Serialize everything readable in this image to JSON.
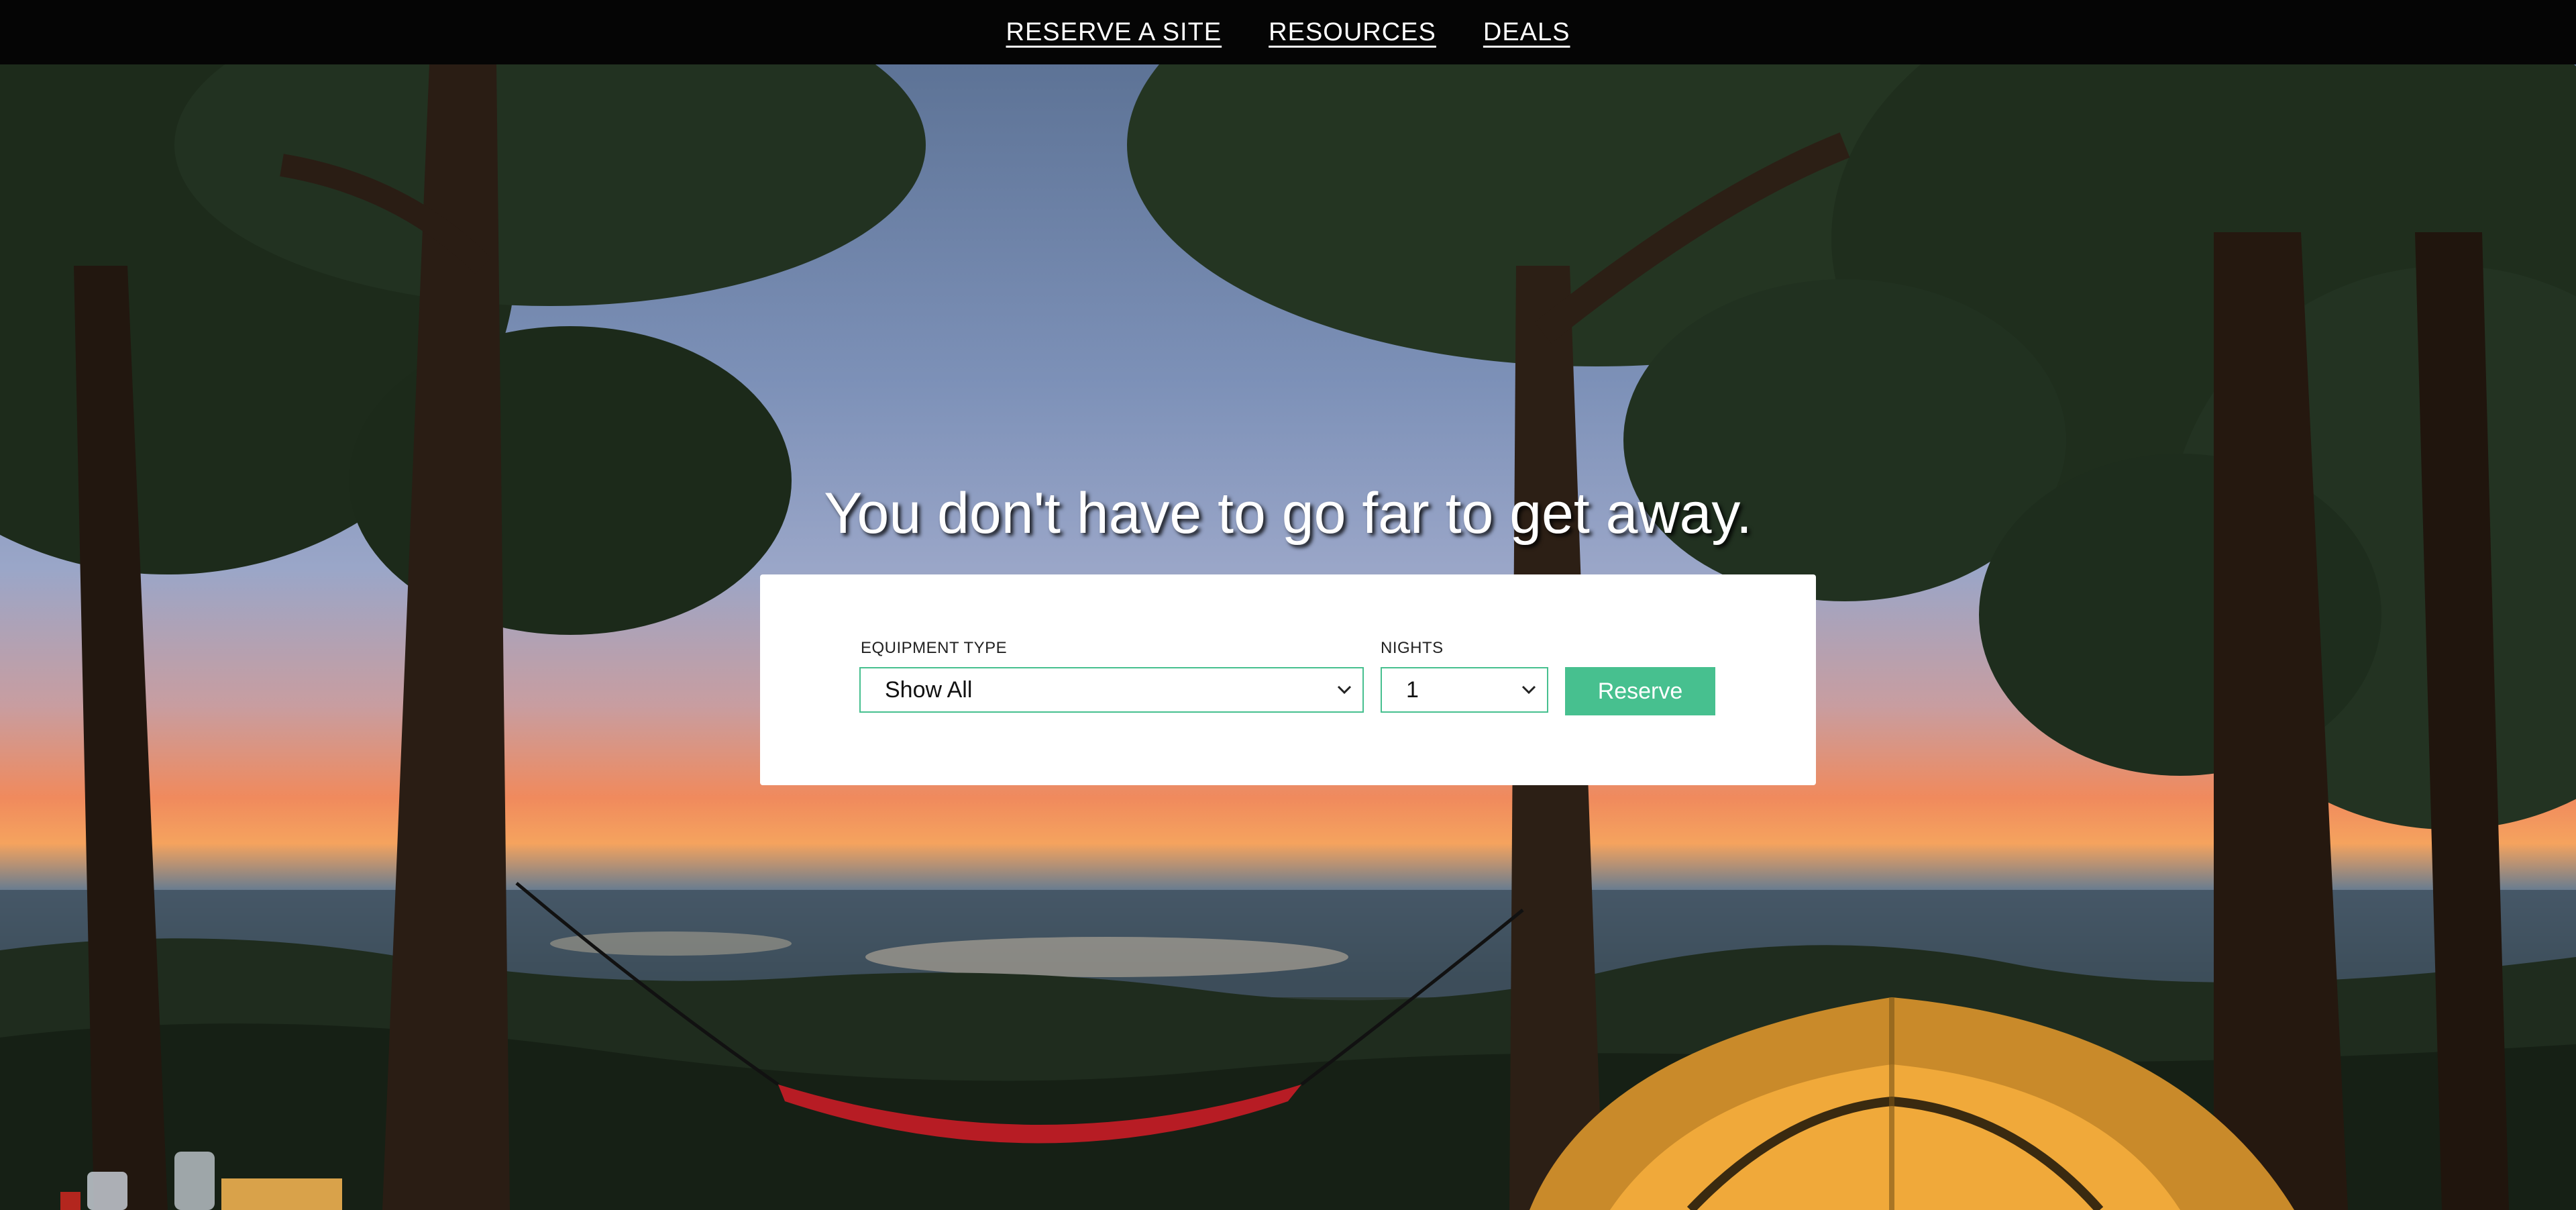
{
  "nav": {
    "items": [
      {
        "label": "RESERVE A SITE"
      },
      {
        "label": "RESOURCES"
      },
      {
        "label": "DEALS"
      }
    ]
  },
  "hero": {
    "headline": "You don't have to go far to get away.",
    "background": "evening campsite with trees, hammock and tent overlooking a valley"
  },
  "search": {
    "equipment_label": "EQUIPMENT TYPE",
    "equipment_value": "Show All",
    "nights_label": "NIGHTS",
    "nights_value": "1",
    "reserve_label": "Reserve"
  },
  "colors": {
    "accent": "#47c08f",
    "nav_bg": "#050505"
  }
}
